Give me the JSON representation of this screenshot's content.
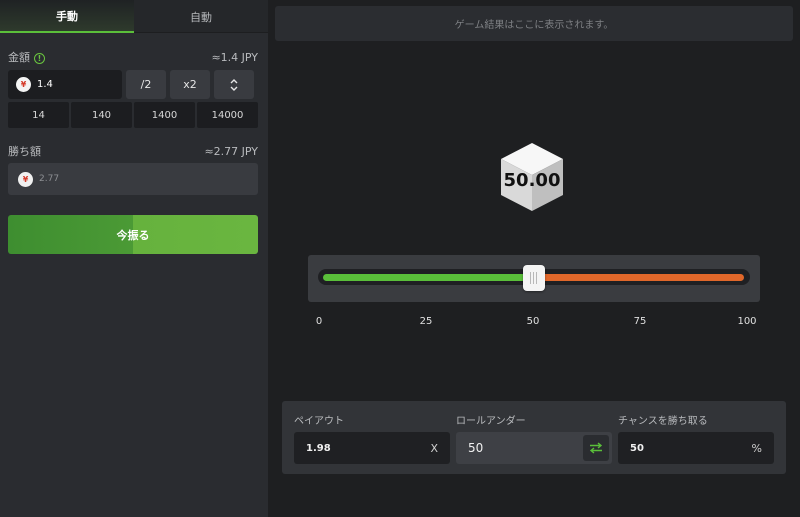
{
  "tabs": {
    "manual": "手動",
    "auto": "自動"
  },
  "bet": {
    "label": "金額",
    "info_icon": "!",
    "approx": "≈1.4 JPY",
    "currency_symbol": "¥",
    "value": "1.4",
    "half_label": "/2",
    "double_label": "x2",
    "presets": [
      "14",
      "140",
      "1400",
      "14000"
    ]
  },
  "win": {
    "label": "勝ち額",
    "approx": "≈2.77 JPY",
    "currency_symbol": "¥",
    "value": "2.77"
  },
  "roll_button": "今振る",
  "result_placeholder": "ゲーム結果はここに表示されます。",
  "dice_value": "50.00",
  "slider": {
    "value": 50,
    "min": 0,
    "max": 100,
    "ticks": [
      "0",
      "25",
      "50",
      "75",
      "100"
    ]
  },
  "payout": {
    "label": "ペイアウト",
    "value": "1.98",
    "suffix": "X"
  },
  "roll_under": {
    "label": "ロールアンダー",
    "value": "50"
  },
  "win_chance": {
    "label": "チャンスを勝ち取る",
    "value": "50",
    "suffix": "%"
  },
  "colors": {
    "accent_green": "#5abf3a",
    "accent_orange": "#e0672a",
    "panel": "#2a2c30",
    "background": "#1e1f21"
  },
  "icons": {
    "currency": "yen-icon",
    "info": "info-icon",
    "swap": "swap-arrows-icon",
    "updown": "chevron-up-down-icon"
  }
}
